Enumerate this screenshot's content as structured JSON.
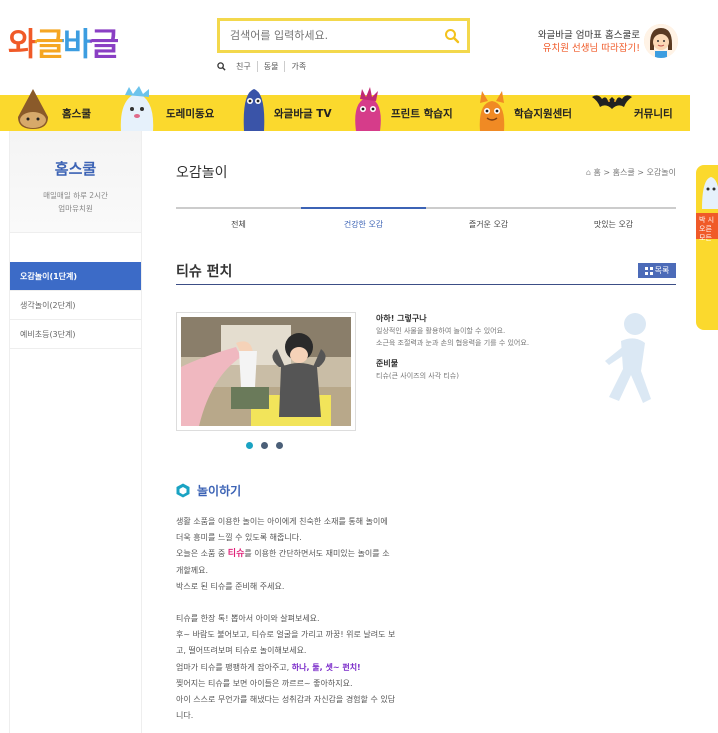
{
  "header": {
    "logo": "와글바글",
    "search_placeholder": "검색어를 입력하세요.",
    "popular_keywords": [
      "친구",
      "동물",
      "가족"
    ],
    "promo_line1": "와글바글 엄마표 홈스쿨로",
    "promo_line2": "유치원 선생님 따라잡기!"
  },
  "nav": {
    "items": [
      {
        "label": "홈스쿨"
      },
      {
        "label": "도레미동요"
      },
      {
        "label": "와글바글 TV"
      },
      {
        "label": "프린트 학습지"
      },
      {
        "label": "학습지원센터"
      },
      {
        "label": "커뮤니티"
      }
    ]
  },
  "sidebar": {
    "title": "홈스쿨",
    "sub1": "매일매일 하루 2시간",
    "sub2": "엄마유치원",
    "items": [
      {
        "label": "오감놀이(1단계)",
        "active": true
      },
      {
        "label": "생각놀이(2단계)"
      },
      {
        "label": "예비초등(3단계)"
      }
    ]
  },
  "main": {
    "page_title": "오감놀이",
    "breadcrumb": "홈 > 홈스쿨 > 오감놀이",
    "tabs": [
      {
        "label": "전체"
      },
      {
        "label": "건강한 오감",
        "active": true
      },
      {
        "label": "즐거운 오감"
      },
      {
        "label": "맛있는 오감"
      }
    ],
    "article_title": "티슈 펀치",
    "list_button": "목록",
    "info": {
      "h1": "아하! 그렇구나",
      "p1": "일상적인 사물을 활용하여 놀이할 수 있어요.",
      "p2": "소근육 조절력과 눈과 손의 협응력을 기를 수 있어요.",
      "h2": "준비물",
      "p3": "티슈(큰 사이즈의 사각 티슈)"
    },
    "play_title": "놀이하기",
    "body": {
      "l1": "생활 소품을 이용한 놀이는 아이에게 친숙한 소재를 통해 놀이에",
      "l2": "더욱 흥미를 느낄 수 있도록 해줍니다.",
      "l3a": "오늘은 소품 중 ",
      "l3b": "티슈",
      "l3c": "를 이용한 간단하면서도 재미있는 놀이를 소",
      "l4": "개할께요.",
      "l5": "박스로 된 티슈를 준비해 주세요.",
      "l6": "티슈를 한장 톡! 뽑아서 아이와 살펴보세요.",
      "l7": "후~ 바람도 불어보고, 티슈로 얼굴을 가리고 까꿍! 위로 날려도 보",
      "l8": "고, 떨어뜨려보며 티슈로 놀이해보세요.",
      "l9a": "엄마가 티슈를 팽팽하게 잡아주고, ",
      "l9b": "하나, 둘, 셋~ 펀치!",
      "l10": "찢어지는 티슈를 보면 아이들은 까르르~ 좋아하지요.",
      "l11": "아이 스스로 무언가를 해냈다는 성취감과 자신감을 경험할 수 있답",
      "l12": "니다."
    }
  },
  "widget": {
    "text1": "박 시",
    "text2": "오른",
    "text3": "모든"
  },
  "colors": {
    "nav_bg": "#fbd92d",
    "accent_blue": "#3c63b5",
    "search_border": "#f3d84c",
    "promo_orange": "#f05a28"
  }
}
